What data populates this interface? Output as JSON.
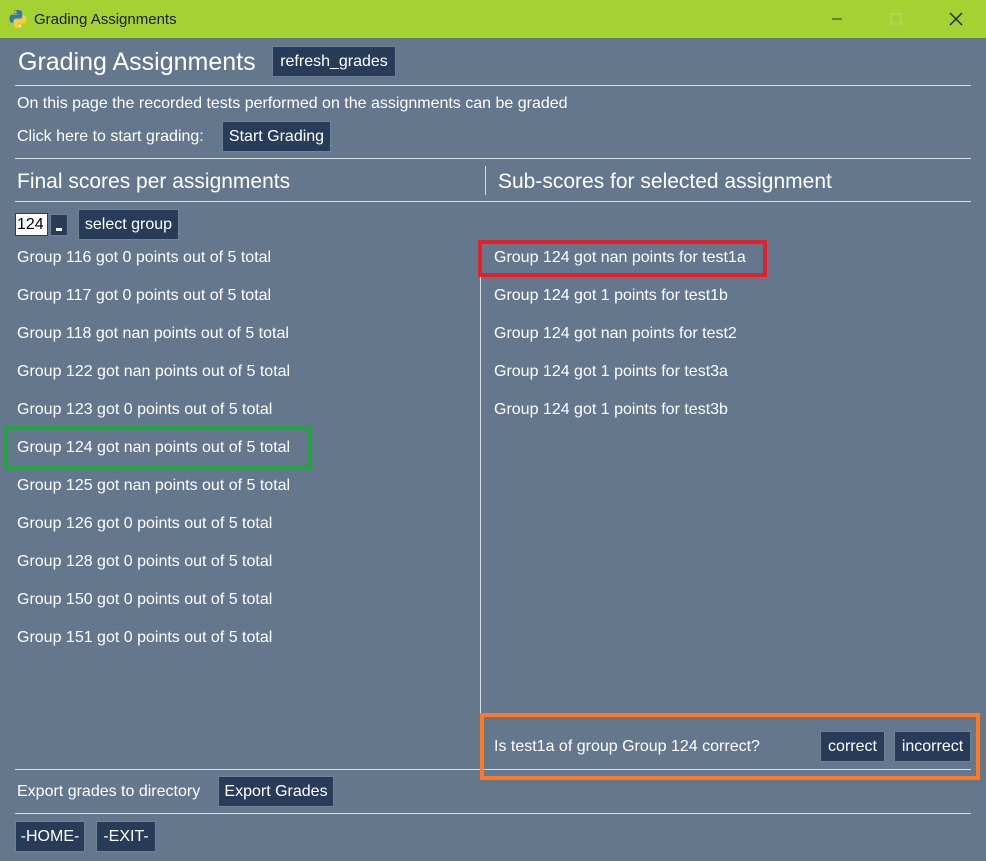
{
  "window": {
    "title": "Grading Assignments",
    "icon": "python-icon"
  },
  "header": {
    "title": "Grading Assignments",
    "refresh_label": "refresh_grades",
    "description": "On this page the recorded tests performed on the assignments can be graded",
    "start_prompt": "Click here to start grading:",
    "start_label": "Start Grading"
  },
  "left": {
    "heading": "Final scores per assignments",
    "selected_group": "124",
    "select_label": "select group",
    "items": [
      "Group 116 got 0 points out of 5 total",
      "Group 117 got 0 points out of 5 total",
      "Group 118 got nan points out of 5 total",
      "Group 122 got nan points out of 5 total",
      "Group 123 got 0 points out of 5 total",
      "Group 124 got nan points out of 5 total",
      "Group 125 got nan points out of 5 total",
      "Group 126 got 0 points out of 5 total",
      "Group 128 got 0 points out of 5 total",
      "Group 150 got 0 points out of 5 total",
      "Group 151 got 0 points out of 5 total"
    ]
  },
  "right": {
    "heading": "Sub-scores for selected assignment",
    "items": [
      "Group 124 got nan points for test1a",
      "Group 124 got 1 points for test1b",
      "Group 124 got nan points for test2",
      "Group 124 got 1 points for test3a",
      "Group 124 got 1 points for test3b"
    ],
    "question": "Is test1a of group Group 124 correct?",
    "correct_label": "correct",
    "incorrect_label": "incorrect"
  },
  "footer": {
    "export_prompt": "Export grades to directory",
    "export_label": "Export Grades",
    "home_label": "-HOME-",
    "exit_label": "-EXIT-"
  },
  "colors": {
    "titlebar": "#a5d233",
    "background": "#64778d",
    "button": "#283c5a",
    "highlight_red": "#e4202b",
    "highlight_green": "#23a440",
    "highlight_orange": "#ff7a22"
  }
}
